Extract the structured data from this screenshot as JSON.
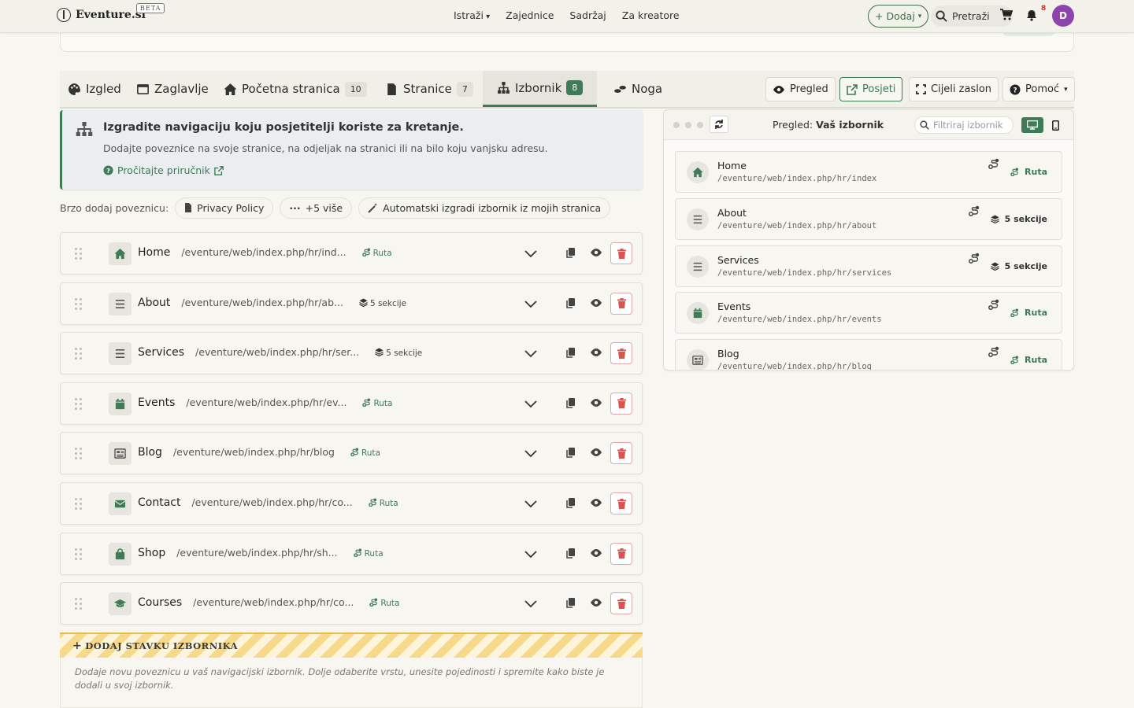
{
  "brand": {
    "name": "Eventure.si",
    "beta": "BETA"
  },
  "nav": {
    "links": [
      "Istraži",
      "Zajednice",
      "Sadržaj",
      "Za kreatore"
    ],
    "add_label": "+ Dodaj",
    "search_label": "Pretraži",
    "notifications": "8",
    "avatar_letter": "D"
  },
  "tabs": [
    {
      "label": "Izgled",
      "count": ""
    },
    {
      "label": "Zaglavlje",
      "count": ""
    },
    {
      "label": "Početna stranica",
      "count": "10"
    },
    {
      "label": "Stranice",
      "count": "7"
    },
    {
      "label": "Izbornik",
      "count": "8"
    },
    {
      "label": "Noga",
      "count": ""
    }
  ],
  "toolbar": {
    "preview": "Pregled",
    "visit": "Posjeti",
    "fullscreen": "Cijeli zaslon",
    "help": "Pomoć"
  },
  "info": {
    "title": "Izgradite navigaciju koju posjetitelji koriste za kretanje.",
    "subtitle": "Dodajte poveznice na svoje stranice, na odjeljak na stranici ili na bilo koju vanjsku adresu.",
    "link": "Pročitajte priručnik"
  },
  "quick_add": {
    "label": "Brzo dodaj poveznicu:",
    "chips": [
      "Privacy Policy",
      "+5 više",
      "Automatski izgradi izbornik iz mojih stranica"
    ]
  },
  "menu_items": [
    {
      "label": "Home",
      "path": "/eventure/web/index.php/hr/ind...",
      "badge": "Ruta",
      "icon": "home-icon"
    },
    {
      "label": "About",
      "path": "/eventure/web/index.php/hr/ab...",
      "badge": "5 sekcije",
      "icon": "list-icon"
    },
    {
      "label": "Services",
      "path": "/eventure/web/index.php/hr/ser...",
      "badge": "5 sekcije",
      "icon": "list-icon"
    },
    {
      "label": "Events",
      "path": "/eventure/web/index.php/hr/ev...",
      "badge": "Ruta",
      "icon": "calendar-icon"
    },
    {
      "label": "Blog",
      "path": "/eventure/web/index.php/hr/blog",
      "badge": "Ruta",
      "icon": "newspaper-icon"
    },
    {
      "label": "Contact",
      "path": "/eventure/web/index.php/hr/co...",
      "badge": "Ruta",
      "icon": "envelope-icon"
    },
    {
      "label": "Shop",
      "path": "/eventure/web/index.php/hr/sh...",
      "badge": "Ruta",
      "icon": "bag-icon"
    },
    {
      "label": "Courses",
      "path": "/eventure/web/index.php/hr/co...",
      "badge": "Ruta",
      "icon": "graduation-cap-icon"
    }
  ],
  "add_item": {
    "label": "DODAJ STAVKU IZBORNIKA",
    "note": "Dodaje novu poveznicu u vaš navigacijski izbornik. Dolje odaberite vrstu, unesite pojedinosti i spremite kako biste je dodali u svoj izbornik."
  },
  "preview": {
    "title_prefix": "Pregled:",
    "title_bold": "Vaš izbornik",
    "filter_placeholder": "Filtriraj izbornik",
    "items": [
      {
        "label": "Home",
        "path": "/eventure/web/index.php/hr/index",
        "badge": "Ruta"
      },
      {
        "label": "About",
        "path": "/eventure/web/index.php/hr/about",
        "badge": "5 sekcije"
      },
      {
        "label": "Services",
        "path": "/eventure/web/index.php/hr/services",
        "badge": "5 sekcije"
      },
      {
        "label": "Events",
        "path": "/eventure/web/index.php/hr/events",
        "badge": "Ruta"
      },
      {
        "label": "Blog",
        "path": "/eventure/web/index.php/hr/blog",
        "badge": "Ruta"
      }
    ]
  },
  "colors": {
    "accent": "#3f7b57",
    "danger": "#d9534f",
    "warning": "#f6d98a"
  }
}
